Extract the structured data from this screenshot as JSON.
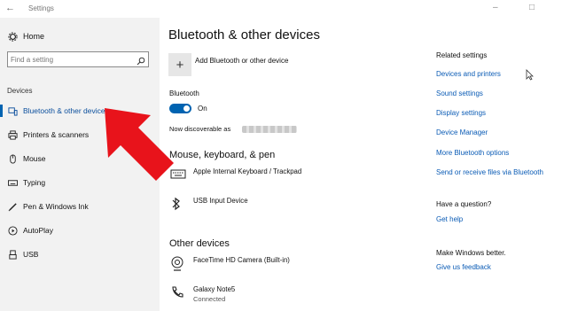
{
  "window": {
    "title": "Settings"
  },
  "sidebar": {
    "home_label": "Home",
    "search_placeholder": "Find a setting",
    "section_label": "Devices",
    "items": [
      {
        "label": "Bluetooth & other devices",
        "icon": "bluetooth-devices-icon",
        "active": true
      },
      {
        "label": "Printers & scanners",
        "icon": "printer-icon"
      },
      {
        "label": "Mouse",
        "icon": "mouse-icon"
      },
      {
        "label": "Typing",
        "icon": "keyboard-icon"
      },
      {
        "label": "Pen & Windows Ink",
        "icon": "pen-icon"
      },
      {
        "label": "AutoPlay",
        "icon": "autoplay-icon"
      },
      {
        "label": "USB",
        "icon": "usb-icon"
      }
    ]
  },
  "main": {
    "title": "Bluetooth & other devices",
    "add_label": "Add Bluetooth or other device",
    "bluetooth_label": "Bluetooth",
    "toggle_state": "On",
    "discoverable_label": "Now discoverable as",
    "section_mouse": "Mouse, keyboard, & pen",
    "mouse_devices": [
      {
        "name": "Apple Internal Keyboard / Trackpad",
        "icon": "keyboard-icon"
      },
      {
        "name": "USB Input Device",
        "icon": "bluetooth-icon"
      }
    ],
    "section_other": "Other devices",
    "other_devices": [
      {
        "name": "FaceTime HD Camera (Built-in)",
        "icon": "webcam-icon"
      },
      {
        "name": "Galaxy Note5",
        "status": "Connected",
        "icon": "phone-icon"
      }
    ]
  },
  "right": {
    "related_heading": "Related settings",
    "links": [
      "Devices and printers",
      "Sound settings",
      "Display settings",
      "Device Manager",
      "More Bluetooth options",
      "Send or receive files via Bluetooth"
    ],
    "question_heading": "Have a question?",
    "help_link": "Get help",
    "better_heading": "Make Windows better.",
    "feedback_link": "Give us feedback"
  },
  "colors": {
    "accent": "#0063b1",
    "link": "#0a5bb5",
    "arrow": "#e8131b",
    "sidebar_bg": "#f2f2f2"
  }
}
